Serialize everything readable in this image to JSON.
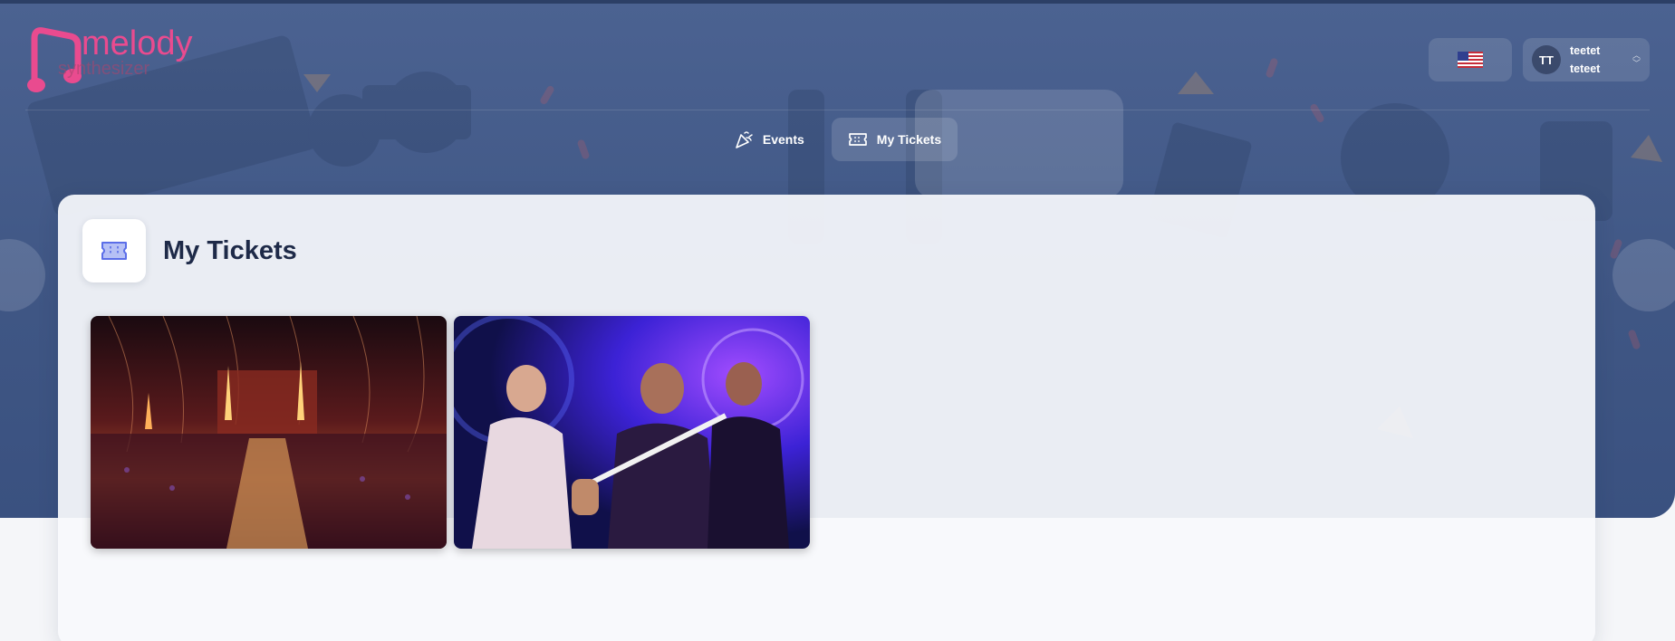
{
  "app": {
    "logo_text": "melody",
    "logo_subtext": "synthesizer"
  },
  "header": {
    "language_icon": "us-flag-icon",
    "user": {
      "initials": "TT",
      "first_name": "teetet",
      "last_name": "teteet"
    }
  },
  "nav": {
    "items": [
      {
        "label": "Events",
        "icon": "party-popper-icon",
        "active": false
      },
      {
        "label": "My Tickets",
        "icon": "ticket-icon",
        "active": true
      }
    ]
  },
  "page": {
    "title": "My Tickets",
    "icon": "ticket-icon"
  },
  "tickets": [
    {
      "image": "festival-crowd-stage-image"
    },
    {
      "image": "rock-band-concert-image"
    }
  ],
  "colors": {
    "hero_bg": "#4b6291",
    "logo_pink": "#e94b8f",
    "title_text": "#1e2a48",
    "icon_accent": "#5b6ee8"
  }
}
